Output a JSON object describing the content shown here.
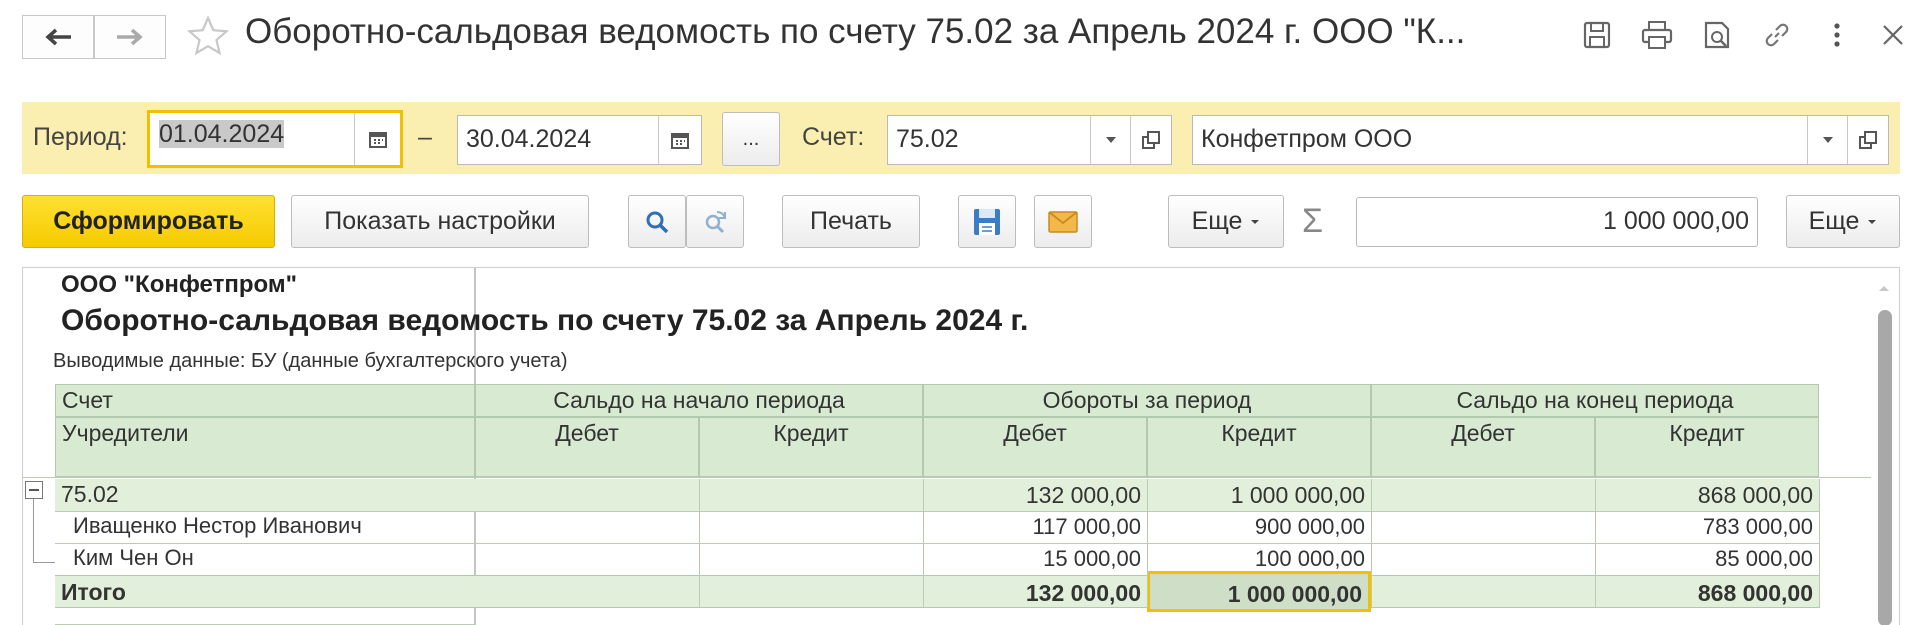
{
  "window": {
    "title": "Оборотно-сальдовая ведомость по счету 75.02 за Апрель 2024 г. ООО \"К..."
  },
  "filters": {
    "period_label": "Период:",
    "date_from": "01.04.2024",
    "dash": "–",
    "date_to": "30.04.2024",
    "dots": "...",
    "account_label": "Счет:",
    "account": "75.02",
    "organization": "Конфетпром ООО"
  },
  "toolbar": {
    "generate": "Сформировать",
    "show_settings": "Показать настройки",
    "print": "Печать",
    "more1": "Еще",
    "sigma": "Σ",
    "sum_value": "1 000 000,00",
    "more2": "Еще"
  },
  "report": {
    "org": "ООО \"Конфетпром\"",
    "title": "Оборотно-сальдовая ведомость по счету 75.02 за Апрель 2024 г.",
    "subtitle": "Выводимые данные: БУ (данные бухгалтерского учета)",
    "header": {
      "account": "Счет",
      "founders": "Учредители",
      "opening": "Сальдо на начало периода",
      "turnover": "Обороты за период",
      "closing": "Сальдо на конец периода",
      "debit": "Дебет",
      "credit": "Кредит"
    },
    "rows": [
      {
        "name": "75.02",
        "open_dt": "",
        "open_ct": "",
        "turn_dt": "132 000,00",
        "turn_ct": "1 000 000,00",
        "close_dt": "",
        "close_ct": "868 000,00"
      },
      {
        "name": "Иващенко Нестор Иванович",
        "open_dt": "",
        "open_ct": "",
        "turn_dt": "117 000,00",
        "turn_ct": "900 000,00",
        "close_dt": "",
        "close_ct": "783 000,00"
      },
      {
        "name": "Ким Чен Он",
        "open_dt": "",
        "open_ct": "",
        "turn_dt": "15 000,00",
        "turn_ct": "100 000,00",
        "close_dt": "",
        "close_ct": "85 000,00"
      }
    ],
    "total": {
      "name": "Итого",
      "open_dt": "",
      "open_ct": "",
      "turn_dt": "132 000,00",
      "turn_ct": "1 000 000,00",
      "close_dt": "",
      "close_ct": "868 000,00"
    }
  }
}
